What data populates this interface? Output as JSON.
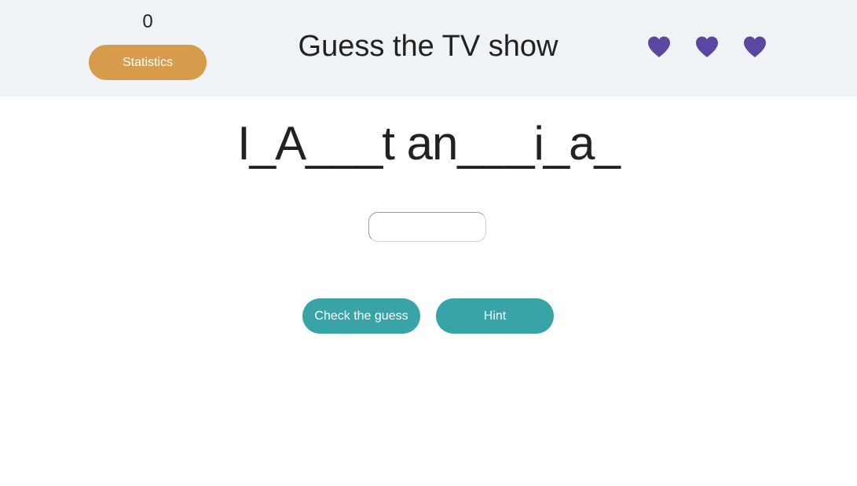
{
  "header": {
    "score": "0",
    "statistics_label": "Statistics",
    "title": "Guess the TV show",
    "lives": [
      {
        "icon": "heart-icon",
        "color": "#5b47a1"
      },
      {
        "icon": "heart-icon",
        "color": "#5b47a1"
      },
      {
        "icon": "heart-icon",
        "color": "#5b47a1"
      }
    ]
  },
  "game": {
    "puzzle": "I_A___t an___i_a_",
    "guess_value": "",
    "check_label": "Check the guess",
    "hint_label": "Hint"
  },
  "colors": {
    "header_bg": "#eff3f5",
    "statistics_button": "#d69c4b",
    "action_buttons": "#38a4a8",
    "hearts": "#5b47a1"
  }
}
